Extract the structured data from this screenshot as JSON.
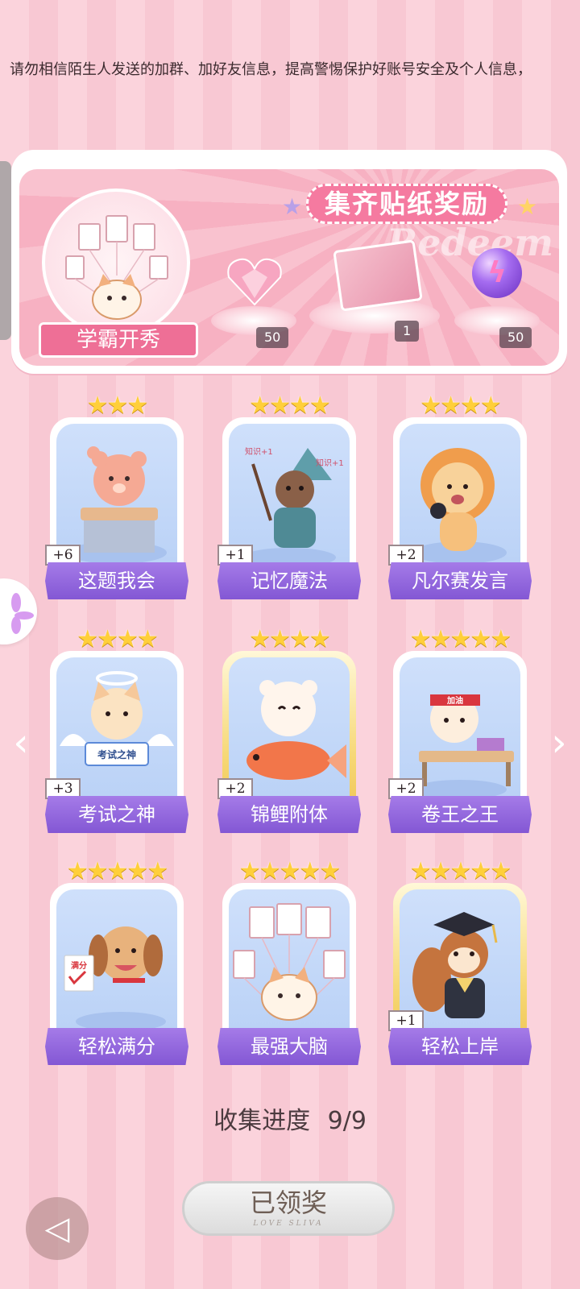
{
  "notice_text": "，请勿相信陌生人发送的加群、加好友信息，提高警惕保护好账号安全及个人信息，",
  "reward_banner": {
    "title": "集齐贴纸奖励",
    "watermark": "Redeem",
    "badge_label": "学霸开秀",
    "rewards": [
      {
        "icon": "pink-heart-gem",
        "quantity": "50"
      },
      {
        "icon": "gift-box",
        "quantity": "1"
      },
      {
        "icon": "purple-orb",
        "quantity": "50"
      }
    ]
  },
  "stickers": [
    {
      "name": "这题我会",
      "count": "+6",
      "stars": "★★★",
      "gold": false,
      "icon": "bear-at-desk"
    },
    {
      "name": "记忆魔法",
      "count": "+1",
      "stars": "★★★★",
      "gold": false,
      "icon": "otter-wizard",
      "art_text": [
        "知识+1",
        "知识+1"
      ]
    },
    {
      "name": "凡尔赛发言",
      "count": "+2",
      "stars": "★★★★",
      "gold": false,
      "icon": "lion-microphone"
    },
    {
      "name": "考试之神",
      "count": "+3",
      "stars": "★★★★",
      "gold": false,
      "icon": "cat-angel",
      "art_text": [
        "考试之神"
      ]
    },
    {
      "name": "锦鲤附体",
      "count": "+2",
      "stars": "★★★★",
      "gold": true,
      "icon": "bear-koi"
    },
    {
      "name": "卷王之王",
      "count": "+2",
      "stars": "★★★★★",
      "gold": false,
      "icon": "cat-studying",
      "art_text": [
        "加油"
      ]
    },
    {
      "name": "轻松满分",
      "count": "",
      "stars": "★★★★★",
      "gold": false,
      "icon": "puppy-fullmark",
      "art_text": [
        "满分"
      ]
    },
    {
      "name": "最强大脑",
      "count": "",
      "stars": "★★★★★",
      "gold": false,
      "icon": "cat-papers"
    },
    {
      "name": "轻松上岸",
      "count": "+1",
      "stars": "★★★★★",
      "gold": true,
      "icon": "squirrel-graduate"
    }
  ],
  "progress": {
    "label": "收集进度",
    "value": "9/9"
  },
  "claim_button": {
    "label": "已领奖",
    "sub_text": "LOVE SLIVA"
  },
  "colors": {
    "accent_pink": "#f57aa0",
    "label_purple": "#8357d4",
    "star_gold": "#ffcf3a"
  }
}
